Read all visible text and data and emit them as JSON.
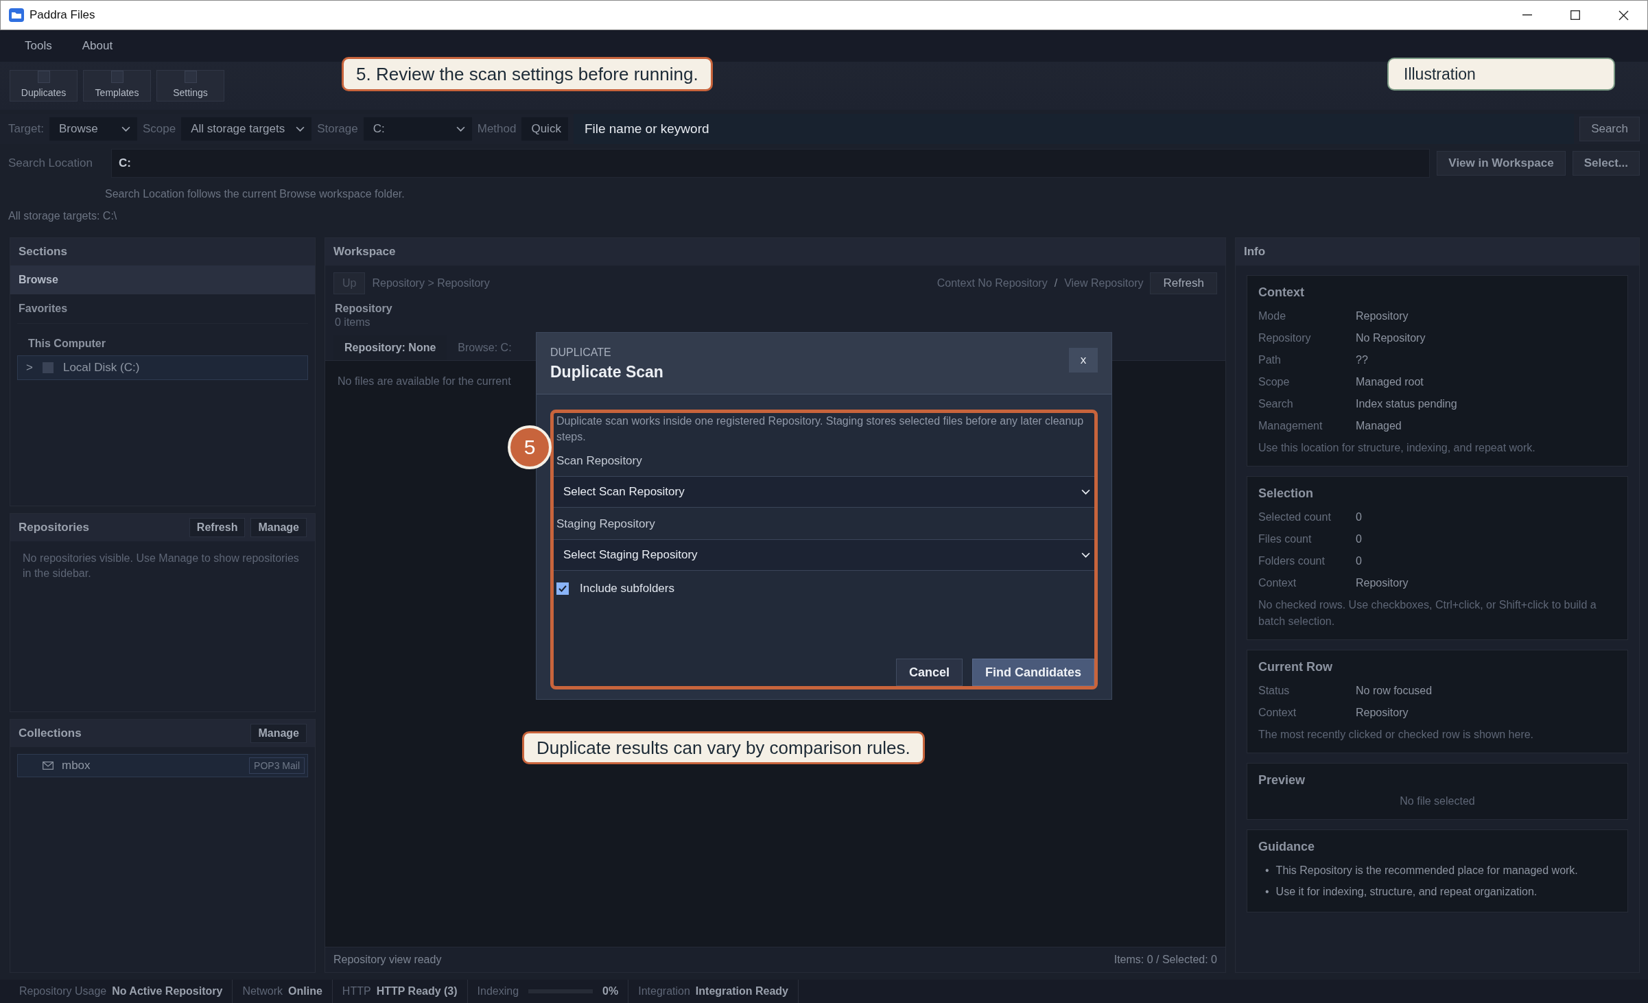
{
  "window": {
    "title": "Paddra Files"
  },
  "menu": [
    {
      "label": "Tools"
    },
    {
      "label": "About"
    }
  ],
  "toolbar": [
    {
      "label": "Duplicates"
    },
    {
      "label": "Templates"
    },
    {
      "label": "Settings"
    }
  ],
  "search_bar": {
    "target_label": "Target:",
    "target": "Browse",
    "scope_label": "Scope",
    "scope": "All storage targets",
    "storage_label": "Storage",
    "storage": "C:",
    "method_label": "Method",
    "method": "Quick",
    "placeholder": "File name or keyword",
    "search_button": "Search"
  },
  "location": {
    "label": "Search Location",
    "value": "C:",
    "view_button": "View in Workspace",
    "select_button": "Select...",
    "hint": "Search Location follows the current Browse workspace folder.",
    "targets": "All storage targets: C:\\"
  },
  "sidebar": {
    "title": "Sections",
    "items": [
      {
        "label": "Browse",
        "selected": true
      },
      {
        "label": "Favorites",
        "selected": false
      }
    ],
    "group": "This Computer",
    "tree": [
      {
        "toggle": ">",
        "label": "Local Disk (C:)",
        "checked": false
      }
    ]
  },
  "repositories": {
    "title": "Repositories",
    "buttons": [
      "Refresh",
      "Manage"
    ],
    "empty": "No repositories visible. Use Manage to show repositories in the sidebar."
  },
  "collections": {
    "title": "Collections",
    "buttons": [
      "Manage"
    ],
    "items": [
      {
        "label": "mbox",
        "tag": "POP3 Mail"
      }
    ]
  },
  "workspace": {
    "title": "Workspace",
    "up": {
      "label": "Up",
      "disabled": true
    },
    "breadcrumb": "Repository > Repository",
    "context": "Context No Repository",
    "separator": "/",
    "view": "View Repository",
    "refresh": "Refresh",
    "heading": "Repository",
    "count": "0 items",
    "tabs": [
      {
        "label": "Repository: None",
        "selected": true
      },
      {
        "label": "Browse: C:",
        "selected": false
      }
    ],
    "empty": "No files are available for the current",
    "status": "Repository view ready",
    "totals": "Items: 0 / Selected: 0"
  },
  "info": {
    "title": "Info",
    "sections": [
      {
        "kind": "fields",
        "title": "Context",
        "rows": [
          {
            "label": "Mode",
            "value": "Repository"
          },
          {
            "label": "Repository",
            "value": "No Repository"
          },
          {
            "label": "Path",
            "value": "??"
          },
          {
            "label": "Scope",
            "value": "Managed root"
          },
          {
            "label": "Search",
            "value": "Index status pending"
          },
          {
            "label": "Management",
            "value": "Managed"
          }
        ],
        "note": "Use this location for structure, indexing, and repeat work."
      },
      {
        "kind": "fields",
        "title": "Selection",
        "rows": [
          {
            "label": "Selected count",
            "value": "0"
          },
          {
            "label": "Files count",
            "value": "0"
          },
          {
            "label": "Folders count",
            "value": "0"
          },
          {
            "label": "Context",
            "value": "Repository"
          }
        ],
        "note": "No checked rows. Use checkboxes, Ctrl+click, or Shift+click to build a batch selection."
      },
      {
        "kind": "fields",
        "title": "Current Row",
        "rows": [
          {
            "label": "Status",
            "value": "No row focused"
          },
          {
            "label": "Context",
            "value": "Repository"
          }
        ],
        "note": "The most recently clicked or checked row is shown here."
      },
      {
        "kind": "preview",
        "title": "Preview",
        "note": "No file selected"
      },
      {
        "kind": "list",
        "title": "Guidance",
        "items": [
          {
            "bullet": "•",
            "text": "This Repository is the recommended place for managed work."
          },
          {
            "bullet": "•",
            "text": "Use it for indexing, structure, and repeat organization."
          }
        ]
      }
    ]
  },
  "dialog": {
    "eyebrow": "DUPLICATE",
    "title": "Duplicate Scan",
    "close": "x",
    "intro": "Duplicate scan works inside one registered Repository. Staging stores selected files before any later cleanup steps.",
    "fields": [
      {
        "label": "Scan Repository",
        "placeholder": "Select Scan Repository"
      },
      {
        "label": "Staging Repository",
        "placeholder": "Select Staging Repository"
      }
    ],
    "include_subfolders": {
      "label": "Include subfolders",
      "checked": true
    },
    "buttons": [
      {
        "label": "Cancel",
        "primary": false
      },
      {
        "label": "Find Candidates",
        "primary": true
      }
    ]
  },
  "status_bar": [
    {
      "kind": "text",
      "label": "Repository Usage",
      "value": "No Active Repository"
    },
    {
      "kind": "text",
      "label": "Network",
      "value": "Online"
    },
    {
      "kind": "text",
      "label": "HTTP",
      "value": "HTTP Ready (3)"
    },
    {
      "kind": "progress",
      "label": "Indexing",
      "level": 0,
      "value": "0%"
    },
    {
      "kind": "text",
      "label": "Integration",
      "value": "Integration Ready"
    }
  ],
  "annotations": {
    "top_callout": "5. Review the scan settings before running.",
    "tag": "Illustration",
    "bottom_callout": "Duplicate results can vary by comparison rules.",
    "step": "5"
  }
}
